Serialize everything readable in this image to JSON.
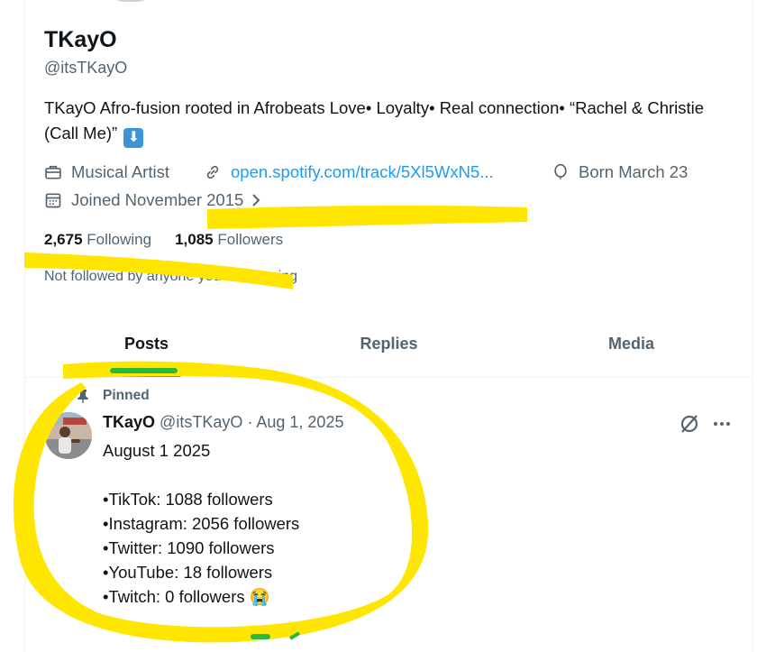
{
  "profile": {
    "display_name": "TKayO",
    "handle": "@itsTKayO",
    "bio_text": "TKayO Afro-fusion rooted in Afrobeats Love• Loyalty• Real connection• “Rachel & Christie (Call Me)”",
    "bio_emoji": "⬇",
    "category": "Musical Artist",
    "link": "open.spotify.com/track/5Xl5WxN5...",
    "birthday": "Born March 23",
    "joined": "Joined November 2015",
    "following_count": "2,675",
    "following_label": "Following",
    "followers_count": "1,085",
    "followers_label": "Followers",
    "not_followed": "Not followed by anyone you’re following"
  },
  "tabs": [
    {
      "label": "Posts",
      "active": true
    },
    {
      "label": "Replies",
      "active": false
    },
    {
      "label": "Media",
      "active": false
    }
  ],
  "post": {
    "pinned_label": "Pinned",
    "author_name": "TKayO",
    "author_handle": "@itsTKayO",
    "separator": "·",
    "date": "Aug 1, 2025",
    "lines": [
      "August 1 2025",
      "",
      "•TikTok: 1088 followers",
      "•Instagram: 2056 followers",
      "•Twitter: 1090 followers",
      "•YouTube: 18 followers",
      "•Twitch: 0 followers"
    ],
    "last_line_emoji": "😭"
  },
  "icons": {
    "category": "briefcase-icon",
    "link": "link-icon",
    "birthday": "balloon-icon",
    "joined": "calendar-icon",
    "pin": "pin-icon",
    "grok": "grok-icon",
    "more": "more-icon"
  },
  "colors": {
    "accent": "#1d9bf0",
    "text": "#0f1419",
    "muted": "#536471",
    "highlight": "#ffe600",
    "green_marks": "#2db83d"
  }
}
